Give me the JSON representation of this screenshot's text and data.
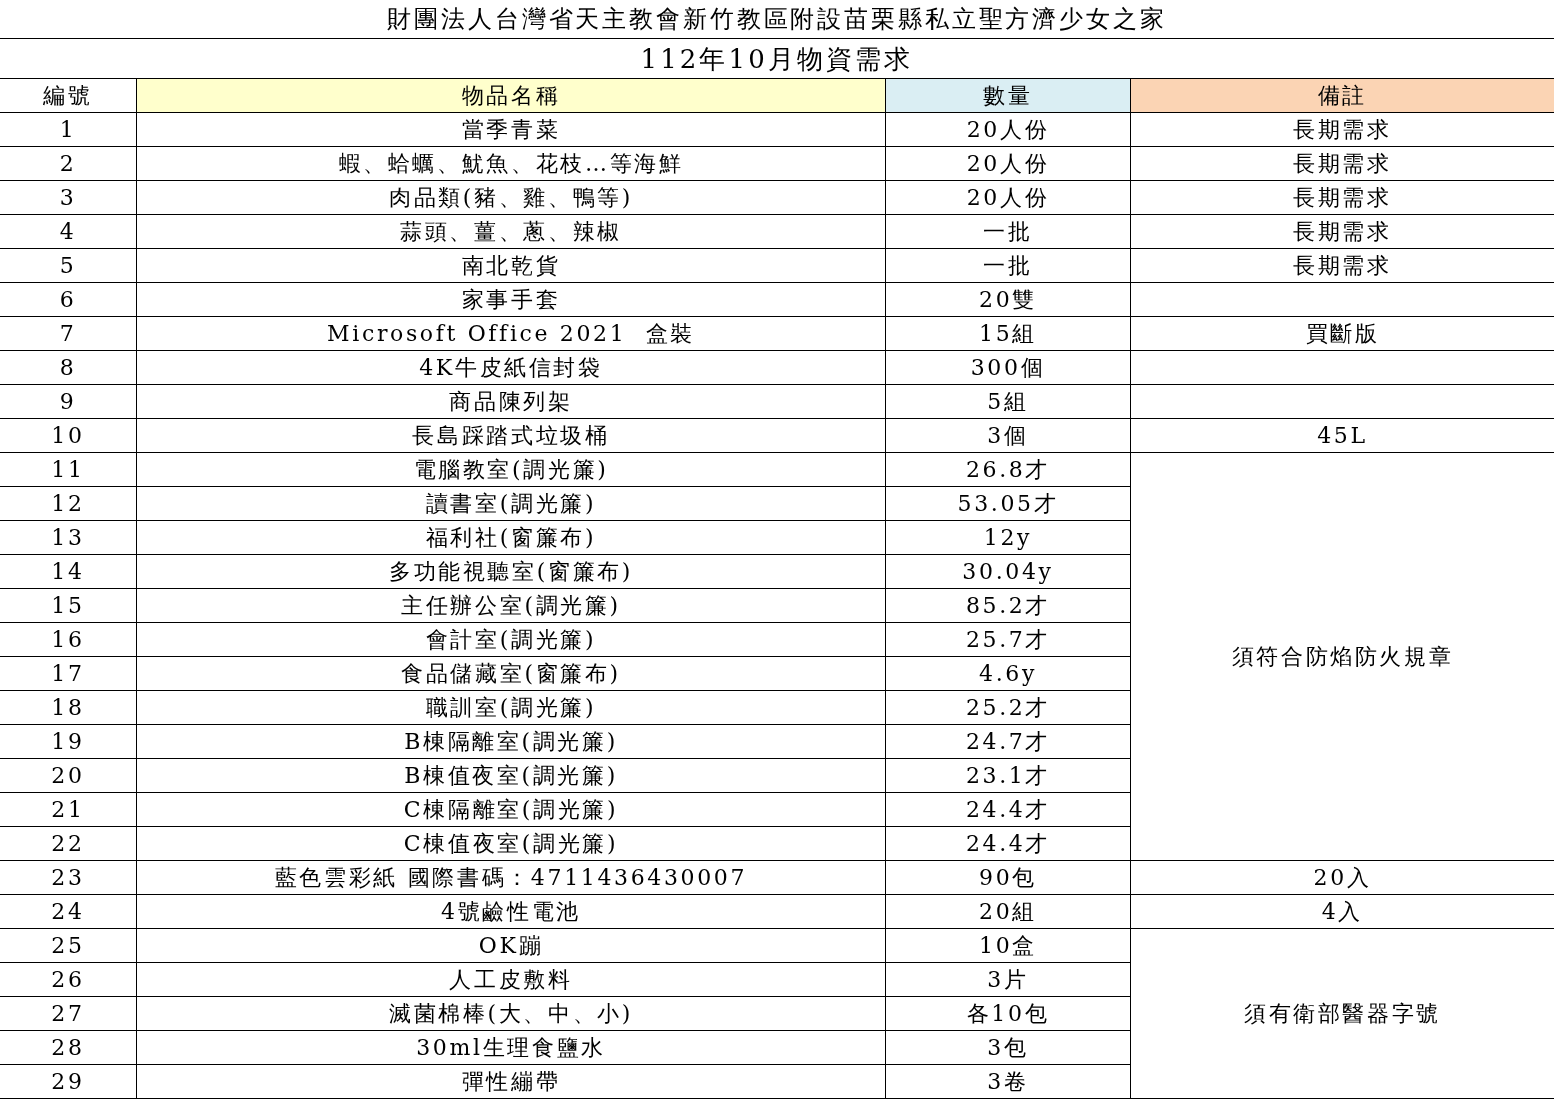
{
  "title": "財團法人台灣省天主教會新竹教區附設苗栗縣私立聖方濟少女之家",
  "subtitle": "112年10月物資需求",
  "columns": [
    {
      "label": "編號",
      "color": "#ffffff"
    },
    {
      "label": "物品名稱",
      "color": "#ffffcc"
    },
    {
      "label": "數量",
      "color": "#daeef3"
    },
    {
      "label": "備註",
      "color": "#fbd4b4"
    }
  ],
  "sections": [
    {
      "remark": "長期需求",
      "rows": [
        {
          "no": "1",
          "item": "當季青菜",
          "quantity": "20人份"
        }
      ]
    },
    {
      "remark": "長期需求",
      "rows": [
        {
          "no": "2",
          "item": "蝦、蛤蠣、魷魚、花枝…等海鮮",
          "quantity": "20人份"
        }
      ]
    },
    {
      "remark": "長期需求",
      "rows": [
        {
          "no": "3",
          "item": "肉品類(豬、雞、鴨等)",
          "quantity": "20人份"
        }
      ]
    },
    {
      "remark": "長期需求",
      "rows": [
        {
          "no": "4",
          "item": "蒜頭、薑、蔥、辣椒",
          "quantity": "一批"
        }
      ]
    },
    {
      "remark": "長期需求",
      "rows": [
        {
          "no": "5",
          "item": "南北乾貨",
          "quantity": "一批"
        }
      ]
    },
    {
      "rows": [
        {
          "no": "6",
          "item": "家事手套",
          "quantity": "20雙"
        }
      ]
    },
    {
      "remark": "買斷版",
      "rows": [
        {
          "no": "7",
          "item": "Microsoft Office 2021  盒裝",
          "quantity": "15組"
        }
      ]
    },
    {
      "rows": [
        {
          "no": "8",
          "item": "4K牛皮紙信封袋",
          "quantity": "300個"
        }
      ]
    },
    {
      "rows": [
        {
          "no": "9",
          "item": "商品陳列架",
          "quantity": "5組"
        }
      ]
    },
    {
      "remark": "45L",
      "rows": [
        {
          "no": "10",
          "item": "長島踩踏式垃圾桶",
          "quantity": "3個"
        }
      ]
    },
    {
      "remark": "須符合防焰防火規章",
      "rows": [
        {
          "no": "11",
          "item": "電腦教室(調光簾)",
          "quantity": "26.8才"
        },
        {
          "no": "12",
          "item": "讀書室(調光簾)",
          "quantity": "53.05才"
        },
        {
          "no": "13",
          "item": "福利社(窗簾布)",
          "quantity": "12y"
        },
        {
          "no": "14",
          "item": "多功能視聽室(窗簾布)",
          "quantity": "30.04y"
        },
        {
          "no": "15",
          "item": "主任辦公室(調光簾)",
          "quantity": "85.2才"
        },
        {
          "no": "16",
          "item": "會計室(調光簾)",
          "quantity": "25.7才"
        },
        {
          "no": "17",
          "item": "食品儲藏室(窗簾布)",
          "quantity": "4.6y"
        },
        {
          "no": "18",
          "item": "職訓室(調光簾)",
          "quantity": "25.2才"
        },
        {
          "no": "19",
          "item": "B棟隔離室(調光簾)",
          "quantity": "24.7才"
        },
        {
          "no": "20",
          "item": "B棟值夜室(調光簾)",
          "quantity": "23.1才"
        },
        {
          "no": "21",
          "item": "C棟隔離室(調光簾)",
          "quantity": "24.4才"
        },
        {
          "no": "22",
          "item": "C棟值夜室(調光簾)",
          "quantity": "24.4才"
        }
      ]
    },
    {
      "remark": "20入",
      "rows": [
        {
          "no": "23",
          "item": "藍色雲彩紙 國際書碼：4711436430007",
          "quantity": "90包"
        }
      ]
    },
    {
      "remark": "4入",
      "rows": [
        {
          "no": "24",
          "item": "4號鹼性電池",
          "quantity": "20組"
        }
      ]
    },
    {
      "remark": "須有衛部醫器字號",
      "rows": [
        {
          "no": "25",
          "item": "OK蹦",
          "quantity": "10盒"
        },
        {
          "no": "26",
          "item": "人工皮敷料",
          "quantity": "3片"
        },
        {
          "no": "27",
          "item": "滅菌棉棒(大、中、小)",
          "quantity": "各10包"
        },
        {
          "no": "28",
          "item": "30ml生理食鹽水",
          "quantity": "3包"
        },
        {
          "no": "29",
          "item": "彈性繃帶",
          "quantity": "3卷"
        }
      ]
    }
  ]
}
